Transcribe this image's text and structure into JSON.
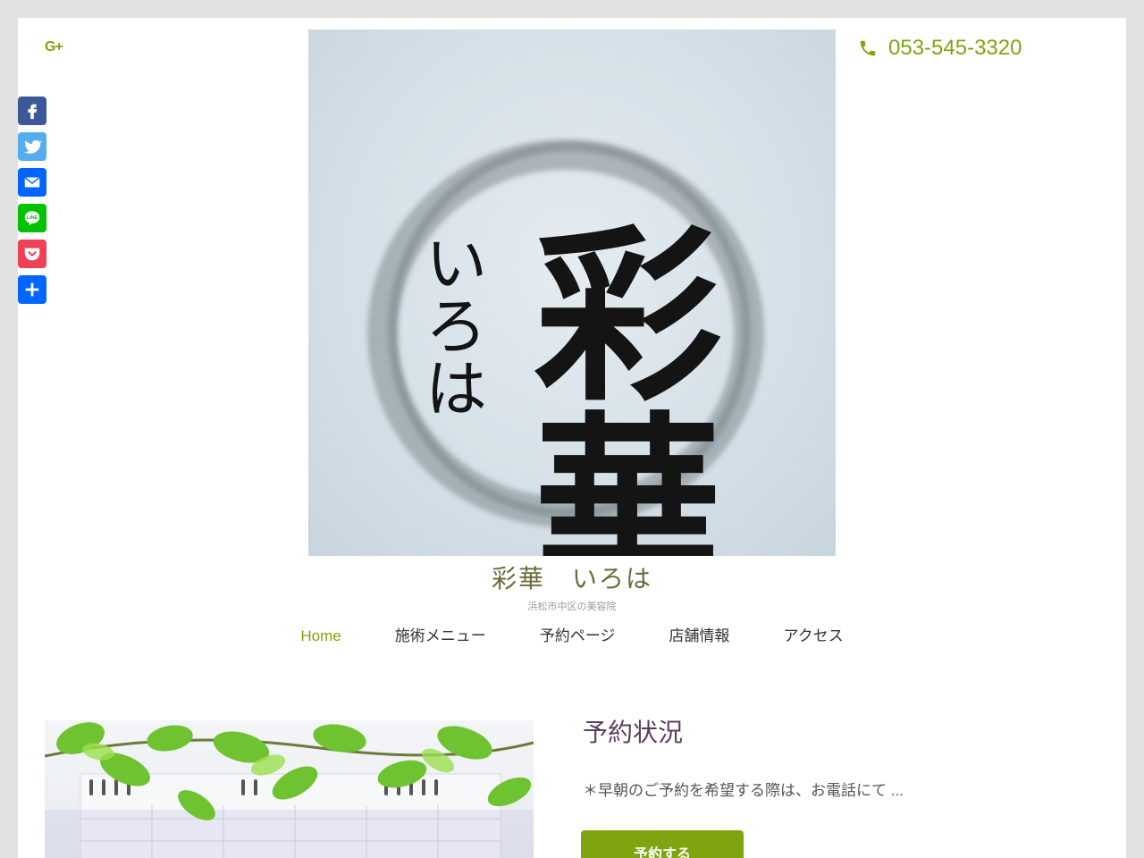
{
  "header": {
    "social_google": "G+",
    "phone": "053-545-3320"
  },
  "share_bar": {
    "items": [
      {
        "name": "facebook",
        "color": "#3b5998",
        "icon": "facebook-icon"
      },
      {
        "name": "twitter",
        "color": "#55acee",
        "icon": "twitter-icon"
      },
      {
        "name": "email",
        "color": "#0166ff",
        "icon": "email-icon"
      },
      {
        "name": "line",
        "color": "#00c300",
        "icon": "line-icon",
        "label": "LINE"
      },
      {
        "name": "pocket",
        "color": "#ee4056",
        "icon": "pocket-icon"
      },
      {
        "name": "share",
        "color": "#0166ff",
        "icon": "plus-icon"
      }
    ]
  },
  "logo": {
    "calligraphy_main": "彩華",
    "calligraphy_sub": "いろは"
  },
  "site": {
    "title": "彩華　いろは",
    "tagline": "浜松市中区の美容院"
  },
  "nav": {
    "items": [
      {
        "label": "Home",
        "active": true
      },
      {
        "label": "施術メニュー"
      },
      {
        "label": "予約ページ"
      },
      {
        "label": "店舗情報"
      },
      {
        "label": "アクセス"
      }
    ]
  },
  "post": {
    "title": "予約状況",
    "excerpt": "＊早朝のご予約を希望する際は、お電話にて ...",
    "button": "予約する"
  },
  "colors": {
    "accent": "#7ea40f",
    "title": "#6b6b3a",
    "post_title": "#5a4060"
  }
}
